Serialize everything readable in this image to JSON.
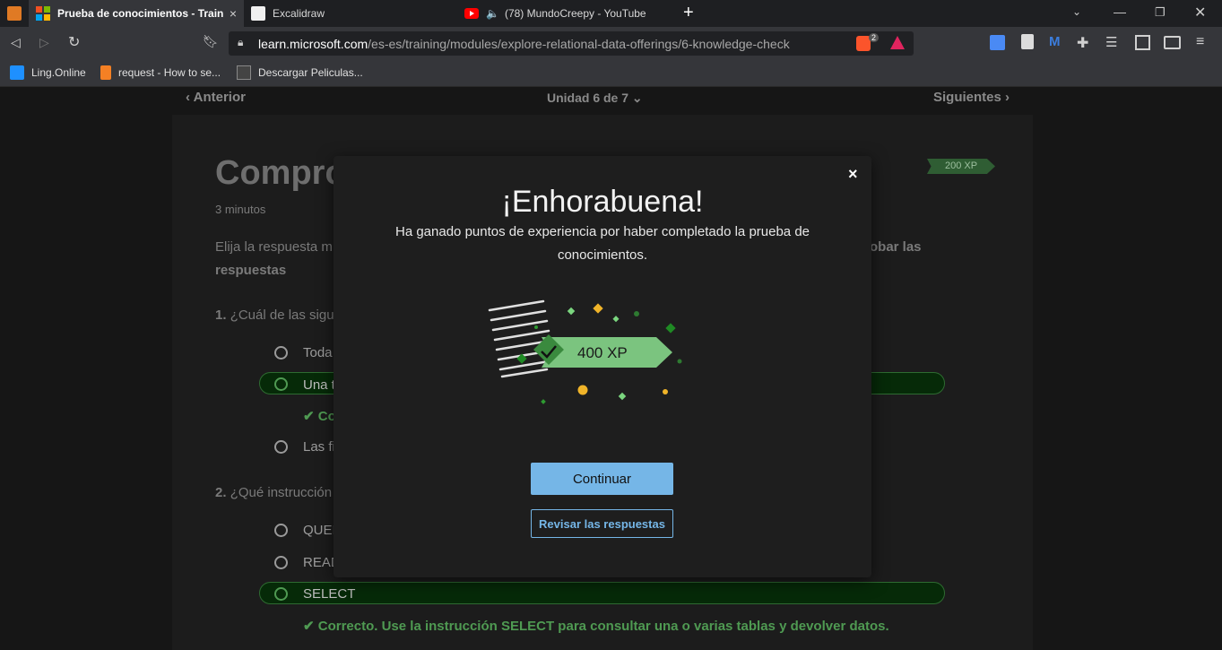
{
  "browser": {
    "tabs": [
      {
        "title": "Prueba de conocimientos - Trainir",
        "active": true
      },
      {
        "title": "Excalidraw",
        "active": false
      },
      {
        "title": "(78) MundoCreepy - YouTube",
        "active": false
      }
    ],
    "new_tab": "+",
    "url_domain": "learn.microsoft.com",
    "url_path": "/es-es/training/modules/explore-relational-data-offerings/6-knowledge-check",
    "shield_count": "2",
    "bookmarks": [
      {
        "label": "Ling.Online"
      },
      {
        "label": "request - How to se..."
      },
      {
        "label": "Descargar Peliculas..."
      }
    ]
  },
  "unit_nav": {
    "prev": "Anterior",
    "current": "Unidad 6 de 7",
    "next": "Siguientes"
  },
  "page": {
    "title": "Compro",
    "duration": "3 minutos",
    "xp_badge": "200 XP",
    "instructions_start": "Elija la respuesta m",
    "instructions_end": "obar las",
    "instructions_line2": "respuestas",
    "q1_number": "1.",
    "q1_text": "¿Cuál de las sigu",
    "q1_options": [
      "Toda",
      "Una t",
      "Las fi"
    ],
    "q1_feedback": "Co",
    "q2_number": "2.",
    "q2_text": "¿Qué instrucción",
    "q2_options": [
      "QUEI",
      "READ",
      "SELECT"
    ],
    "q2_feedback": "Correcto. Use la instrucción SELECT para consultar una o varias tablas y devolver datos."
  },
  "modal": {
    "title": "¡Enhorabuena!",
    "message": "Ha ganado puntos de experiencia por haber completado la prueba de conocimientos.",
    "xp": "400 XP",
    "continue_label": "Continuar",
    "review_label": "Revisar las respuestas",
    "close": "×"
  },
  "colors": {
    "accent_blue": "#75b6e7",
    "success_green": "#4f9a52",
    "xp_green": "#7bc47f"
  }
}
